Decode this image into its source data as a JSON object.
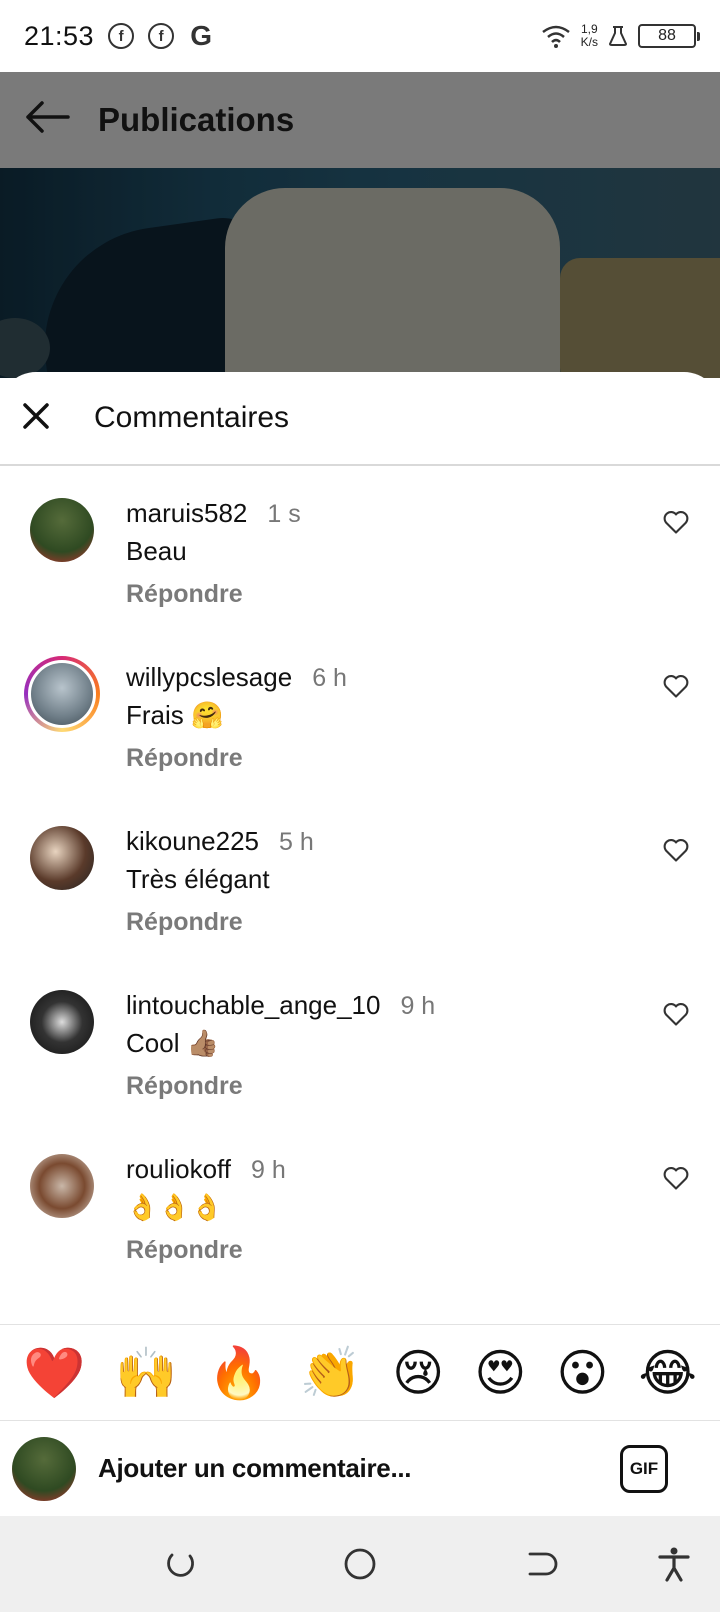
{
  "status_bar": {
    "time": "21:53",
    "left_icons": [
      "facebook-icon",
      "facebook-icon",
      "google-icon"
    ],
    "net_speed_value": "1,9",
    "net_speed_unit": "K/s",
    "battery": "88"
  },
  "appbar": {
    "title": "Publications"
  },
  "sheet": {
    "title": "Commentaires"
  },
  "comments": [
    {
      "user": "maruis582",
      "time": "1 s",
      "text": "Beau",
      "reply": "Répondre"
    },
    {
      "user": "willypcslesage",
      "time": "6 h",
      "text": "Frais 🤗",
      "reply": "Répondre"
    },
    {
      "user": "kikoune225",
      "time": "5 h",
      "text": "Très élégant",
      "reply": "Répondre"
    },
    {
      "user": "lintouchable_ange_10",
      "time": "9 h",
      "text": "Cool 👍🏽",
      "reply": "Répondre"
    },
    {
      "user": "rouliokoff",
      "time": "9 h",
      "text": "👌👌👌",
      "reply": "Répondre"
    }
  ],
  "emoji_bar": [
    "❤️",
    "🙌",
    "🔥",
    "👏",
    "😢",
    "😍",
    "😮",
    "😂"
  ],
  "input": {
    "placeholder": "Ajouter un commentaire...",
    "gif_label": "GIF"
  }
}
